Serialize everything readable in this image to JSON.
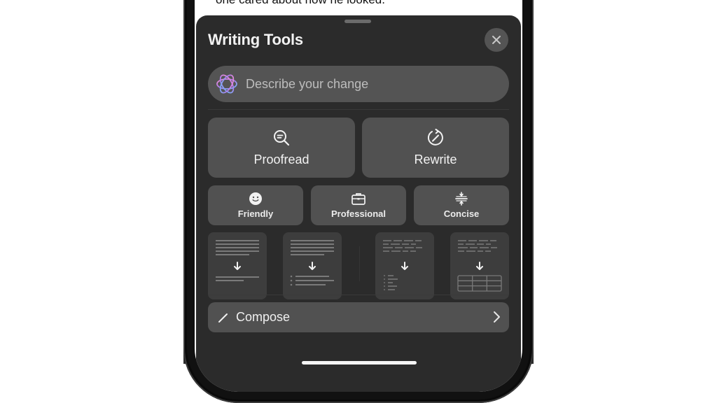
{
  "document": {
    "visible_text": "one cared about how he looked."
  },
  "sheet": {
    "title": "Writing Tools",
    "close_icon": "xmark-icon",
    "describe": {
      "placeholder": "Describe your change",
      "value": "",
      "icon": "apple-intelligence-icon"
    },
    "primary_actions": [
      {
        "label": "Proofread",
        "icon": "magnifier-text-icon"
      },
      {
        "label": "Rewrite",
        "icon": "rewrite-circle-pencil-icon"
      }
    ],
    "tone_actions": [
      {
        "label": "Friendly",
        "icon": "smiley-face-icon"
      },
      {
        "label": "Professional",
        "icon": "briefcase-icon"
      },
      {
        "label": "Concise",
        "icon": "compress-icon"
      }
    ],
    "format_actions": [
      {
        "label": "Summary",
        "icon": "summary-doc-icon"
      },
      {
        "label": "Key Points",
        "icon": "key-points-doc-icon"
      },
      {
        "label": "List",
        "icon": "list-doc-icon"
      },
      {
        "label": "Table",
        "icon": "table-doc-icon"
      }
    ],
    "compose": {
      "label": "Compose",
      "icon": "pencil-icon",
      "trailing_icon": "chevron-right-icon"
    }
  },
  "colors": {
    "sheet_bg": "#2b2b2b",
    "button_bg": "#515151",
    "tile_bg": "#3d3d3d",
    "text": "#f2f2f2"
  }
}
